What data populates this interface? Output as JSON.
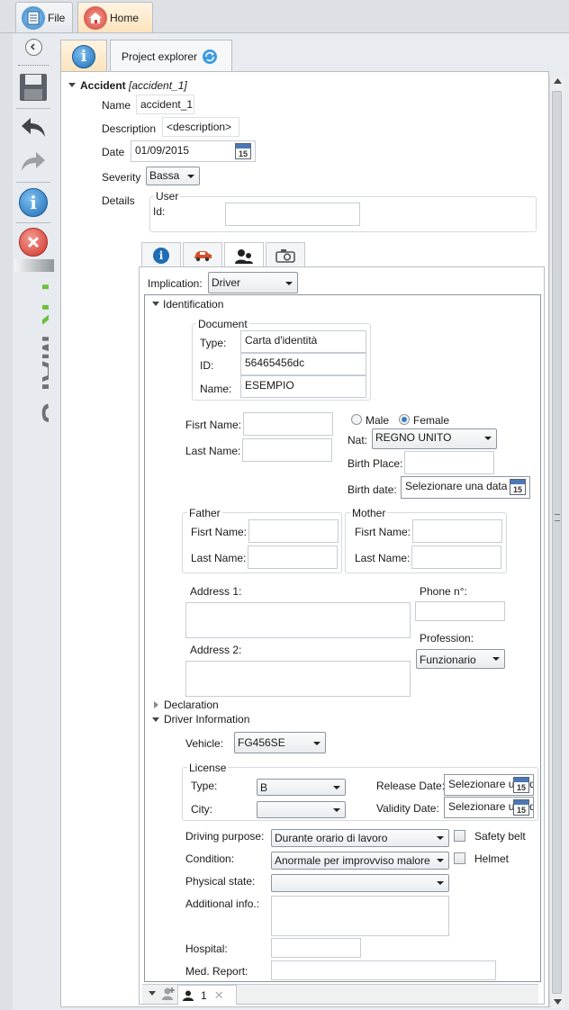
{
  "topbar": {
    "file_label": "File",
    "home_label": "Home"
  },
  "left_toolbar": {
    "icons": [
      "collapse-icon",
      "save-icon",
      "undo-icon",
      "redo-icon",
      "info-icon",
      "close-icon"
    ],
    "logo": "PKMAPS"
  },
  "right_tabs": {
    "project_explorer_label": "Project explorer"
  },
  "accident": {
    "header": "Accident",
    "header_id": "[accident_1]",
    "name_label": "Name",
    "name_value": "accident_1",
    "description_label": "Description",
    "description_value": "<description>",
    "date_label": "Date",
    "date_value": "01/09/2015",
    "severity_label": "Severity",
    "severity_value": "Bassa",
    "details_label": "Details",
    "user_group": "User",
    "id_label": "Id:",
    "id_value": ""
  },
  "panel": {
    "implication_label": "Implication:",
    "implication_value": "Driver",
    "identification": "Identification",
    "document_group": "Document",
    "type_label": "Type:",
    "type_value": "Carta d'identità",
    "id_label": "ID:",
    "id_value": "56465456dc",
    "name_label": "Name:",
    "name_value": "ESEMPIO",
    "first_name_label": "Fisrt Name:",
    "last_name_label": "Last Name:",
    "male_label": "Male",
    "female_label": "Female",
    "nat_label": "Nat:",
    "nat_value": "REGNO UNITO",
    "birth_place_label": "Birth Place:",
    "birth_date_label": "Birth date:",
    "birth_date_value": "Selezionare una data",
    "father_group": "Father",
    "mother_group": "Mother",
    "address1_label": "Address 1:",
    "address2_label": "Address 2:",
    "phone_label": "Phone n°:",
    "profession_label": "Profession:",
    "profession_value": "Funzionario",
    "declaration": "Declaration",
    "driver_info": "Driver Information",
    "vehicle_label": "Vehicle:",
    "vehicle_value": "FG456SE",
    "license_group": "License",
    "license_type_label": "Type:",
    "license_type_value": "B",
    "city_label": "City:",
    "city_value": "",
    "release_date_label": "Release Date:",
    "release_date_value": "Selezionare una data",
    "validity_date_label": "Validity Date:",
    "validity_date_value": "Selezionare una data",
    "driving_purpose_label": "Driving purpose:",
    "driving_purpose_value": "Durante orario di lavoro",
    "safety_belt_label": "Safety belt",
    "condition_label": "Condition:",
    "condition_value": "Anormale per improvviso malore",
    "helmet_label": "Helmet",
    "physical_state_label": "Physical state:",
    "physical_state_value": "",
    "additional_info_label": "Additional info.:",
    "hospital_label": "Hospital:",
    "med_report_label": "Med. Report:"
  },
  "bottom_tabs": {
    "person_tab_label": "1"
  },
  "colors": {
    "accent": "#1f78c8",
    "logo_green": "#6cbf3e",
    "logo_gray": "#6d7278",
    "active_tab": "#fbe3bd"
  }
}
